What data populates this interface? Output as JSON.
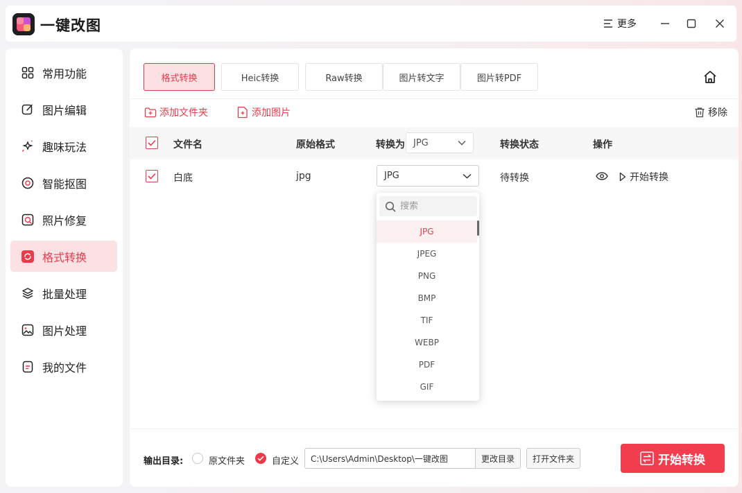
{
  "app": {
    "title": "一键改图",
    "more_label": "更多"
  },
  "sidebar": {
    "items": [
      {
        "label": "常用功能",
        "icon": "grid-icon"
      },
      {
        "label": "图片编辑",
        "icon": "edit-icon"
      },
      {
        "label": "趣味玩法",
        "icon": "sparkle-icon"
      },
      {
        "label": "智能抠图",
        "icon": "target-icon"
      },
      {
        "label": "照片修复",
        "icon": "repair-icon"
      },
      {
        "label": "格式转换",
        "icon": "convert-icon",
        "active": true
      },
      {
        "label": "批量处理",
        "icon": "layers-icon"
      },
      {
        "label": "图片处理",
        "icon": "image-icon"
      },
      {
        "label": "我的文件",
        "icon": "file-icon"
      }
    ]
  },
  "tabs": [
    {
      "label": "格式转换",
      "active": true
    },
    {
      "label": "Heic转换"
    },
    {
      "label": "Raw转换"
    },
    {
      "label": "图片转文字"
    },
    {
      "label": "图片转PDF"
    }
  ],
  "toolbar": {
    "add_folder": "添加文件夹",
    "add_image": "添加图片",
    "remove": "移除"
  },
  "table": {
    "headers": {
      "filename": "文件名",
      "original_format": "原始格式",
      "convert_to": "转换为",
      "status": "转换状态",
      "actions": "操作"
    },
    "header_format_value": "JPG",
    "rows": [
      {
        "filename": "白底",
        "original_format": "jpg",
        "target_format": "JPG",
        "status": "待转换",
        "action_label": "开始转换"
      }
    ]
  },
  "dropdown": {
    "search_placeholder": "搜索",
    "options": [
      "JPG",
      "JPEG",
      "PNG",
      "BMP",
      "TIF",
      "WEBP",
      "PDF",
      "GIF"
    ],
    "selected": "JPG"
  },
  "footer": {
    "output_label": "输出目录:",
    "option_original": "原文件夹",
    "option_custom": "自定义",
    "path": "C:\\Users\\Admin\\Desktop\\一键改图",
    "change_dir": "更改目录",
    "open_folder": "打开文件夹",
    "start_button": "开始转换"
  },
  "colors": {
    "accent": "#ea3b4b",
    "accent_bg": "#fbe1e3",
    "start_button": "#f23d4f"
  }
}
